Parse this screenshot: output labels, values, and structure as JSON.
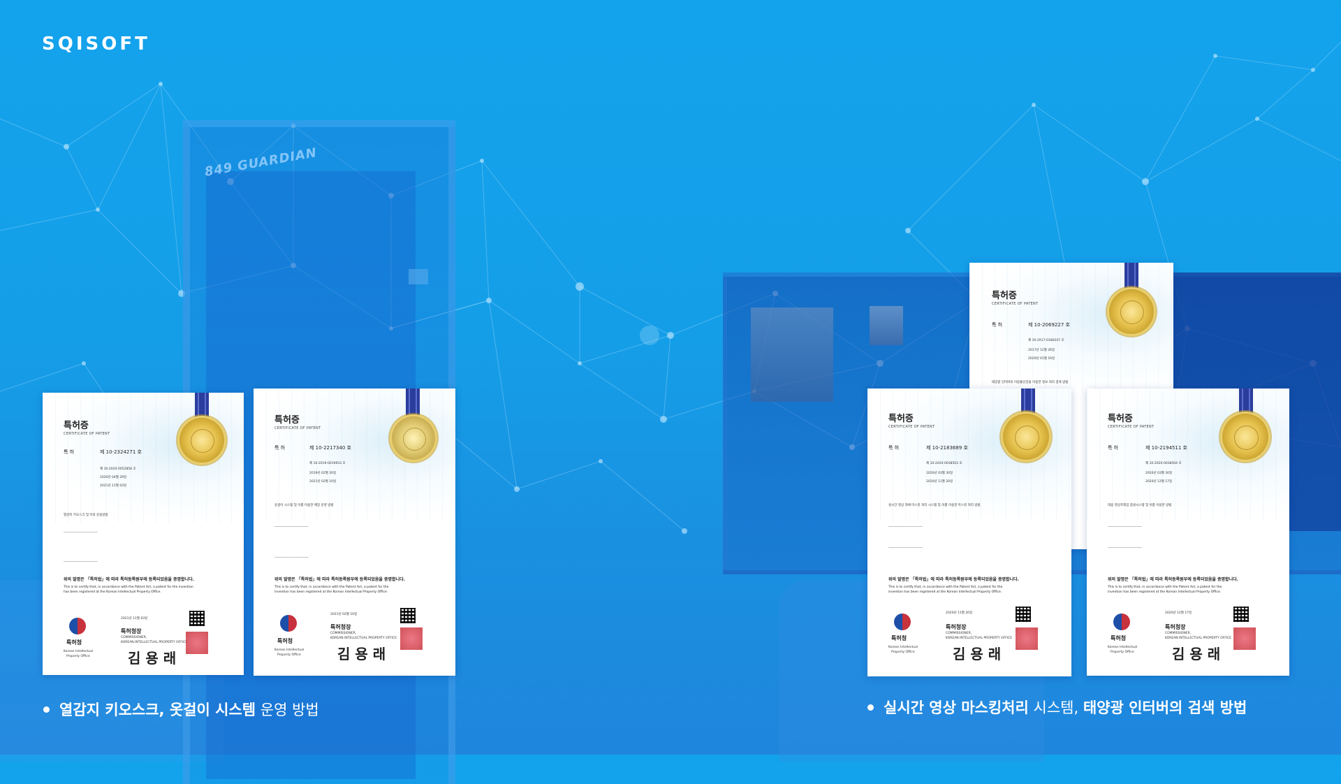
{
  "brand": {
    "logo": "SQISOFT"
  },
  "background": {
    "kiosk_label": "849 GUARDIAN"
  },
  "certificates": [
    {
      "title": "특허증",
      "subtitle": "CERTIFICATE OF PATENT",
      "patent_number": "제 10-2324271 호",
      "application_number": "제 10-2020-0052858 호",
      "filing_date": "2020년 04월 29일",
      "registration_date": "2021년 11월 03일",
      "invention_title": "열감지 키오스크 및 이의 운용방법",
      "statement_ko": "위의 발명은 「특허법」에 따라 특허등록원부에 등록되었음을 증명합니다.",
      "statement_en_1": "This is to certify that, in accordance with the Patent Act, a patent for the invention",
      "statement_en_2": "has been registered at the Korean Intellectual Property Office.",
      "issue_date": "2021년 11월 03일",
      "office_ko": "특허청",
      "office_en_1": "Korean Intellectual",
      "office_en_2": "Property Office",
      "commissioner_ko": "특허청장",
      "commissioner_en_1": "COMMISSIONER,",
      "commissioner_en_2": "KOREAN INTELLECTUAL PROPERTY OFFICE",
      "signature": "김 용 래"
    },
    {
      "title": "특허증",
      "subtitle": "CERTIFICATE OF PATENT",
      "patent_number": "제 10-2217340 호",
      "application_number": "제 10-2019-0019933 호",
      "filing_date": "2019년 02월 20일",
      "registration_date": "2021년 02월 10일",
      "invention_title": "옷걸이 시스템 및 이를 이용한 매장 운영 방법",
      "statement_ko": "위의 발명은 「특허법」에 따라 특허등록원부에 등록되었음을 증명합니다.",
      "statement_en_1": "This is to certify that, in accordance with the Patent Act, a patent for the",
      "statement_en_2": "invention has been registered at the Korean Intellectual Property Office.",
      "issue_date": "2021년 02월 10일",
      "office_ko": "특허청",
      "office_en_1": "Korean Intellectual",
      "office_en_2": "Property Office",
      "commissioner_ko": "특허청장",
      "commissioner_en_1": "COMMISSIONER,",
      "commissioner_en_2": "KOREAN INTELLECTUAL PROPERTY OFFICE",
      "signature": "김 용 래"
    },
    {
      "title": "특허증",
      "subtitle": "CERTIFICATE OF PATENT",
      "patent_number": "제 10-2069227 호",
      "application_number": "제 10-2017-0180247 호",
      "filing_date": "2017년 12월 26일",
      "registration_date": "2020년 01월 16일",
      "invention_title": "태양광 인터버의 이동통신망을 이용한 정보 처리 검색 방법"
    },
    {
      "title": "특허증",
      "subtitle": "CERTIFICATE OF PATENT",
      "patent_number": "제 10-2183689 호",
      "application_number": "제 10-2020-0038503 호",
      "filing_date": "2020년 03월 30일",
      "registration_date": "2020년 11월 20일",
      "invention_title": "실시간 영상 객체 마스킹 처리 시스템 및 이를 이용한 마스킹 처리 방법",
      "statement_ko": "위의 발명은 「특허법」에 따라 특허등록원부에 등록되었음을 증명합니다.",
      "statement_en_1": "This is to certify that, in accordance with the Patent Act, a patent for the",
      "statement_en_2": "invention has been registered at the Korean Intellectual Property Office.",
      "issue_date": "2020년 11월 20일",
      "office_ko": "특허청",
      "office_en_1": "Korean Intellectual",
      "office_en_2": "Property Office",
      "commissioner_ko": "특허청장",
      "commissioner_en_1": "COMMISSIONER,",
      "commissioner_en_2": "KOREAN INTELLECTUAL PROPERTY OFFICE",
      "signature": "김 용 래"
    },
    {
      "title": "특허증",
      "subtitle": "CERTIFICATE OF PATENT",
      "patent_number": "제 10-2194511 호",
      "application_number": "제 10-2020-0038504 호",
      "filing_date": "2020년 03월 30일",
      "registration_date": "2020년 12월 17일",
      "invention_title": "대용 영상프레임 합성시스템 및 이를 이용한 방법",
      "statement_ko": "위의 발명은 「특허법」에 따라 특허등록원부에 등록되었음을 증명합니다.",
      "statement_en_1": "This is to certify that, in accordance with the Patent Act, a patent for the",
      "statement_en_2": "invention has been registered at the Korean Intellectual Property Office.",
      "issue_date": "2020년 12월 17일",
      "office_ko": "특허청",
      "office_en_1": "Korean Intellectual",
      "office_en_2": "Property Office",
      "commissioner_ko": "특허청장",
      "commissioner_en_1": "COMMISSIONER,",
      "commissioner_en_2": "KOREAN INTELLECTUAL PROPERTY OFFICE",
      "signature": "김 용 래"
    }
  ],
  "captions": {
    "left": {
      "bold": "열감지 키오스크, 옷걸이 시스템",
      "normal": " 운영 방법"
    },
    "right": {
      "bold1": "실시간 영상 마스킹처리",
      "normal": " 시스템, ",
      "bold2": "태양광 인터버의 검색 방법"
    }
  },
  "colors": {
    "background": "#159ee8",
    "text": "#ffffff",
    "seal_gold": "#e6c24e",
    "ribbon": "#2b3d9c"
  }
}
